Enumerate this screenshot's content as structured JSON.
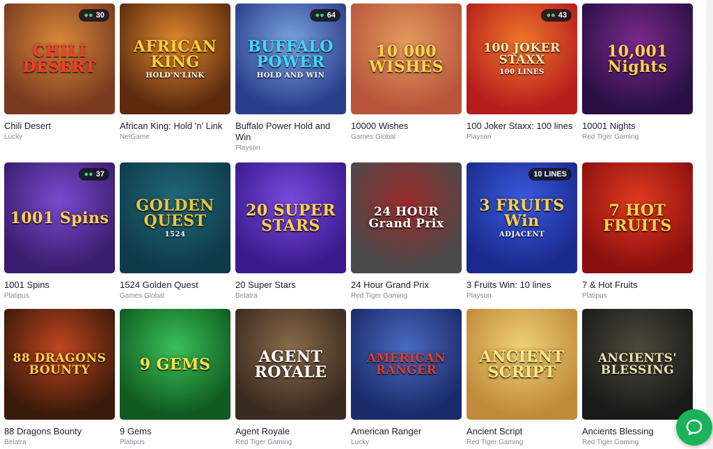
{
  "games": [
    {
      "title": "Chili Desert",
      "provider": "Lucky",
      "logo": "CHILI DESERT",
      "badge": "30",
      "bg": "#7a3a1f",
      "bg2": "#d98a3c",
      "logo_color": "#ff3a2a"
    },
    {
      "title": "African King: Hold 'n' Link",
      "provider": "NetGame",
      "logo": "AFRICAN KING",
      "sub": "HOLD'N'LINK",
      "bg": "#5b2a0f",
      "bg2": "#e0892e",
      "logo_color": "#ffcf3a"
    },
    {
      "title": "Buffalo Power Hold and Win",
      "provider": "Playson",
      "logo": "BUFFALO POWER",
      "sub": "HOLD AND WIN",
      "badge": "64",
      "bg": "#2a3e8c",
      "bg2": "#7ca4e0",
      "logo_color": "#3fd6ff"
    },
    {
      "title": "10000 Wishes",
      "provider": "Games Global",
      "logo": "10 000 WISHES",
      "bg": "#b8553a",
      "bg2": "#e39a5f",
      "logo_color": "#ffd24a"
    },
    {
      "title": "100 Joker Staxx: 100 lines",
      "provider": "Playson",
      "logo": "100 JOKER STAXX",
      "sub": "100 LINES",
      "badge": "43",
      "bg": "#b51d1d",
      "bg2": "#f0782a",
      "logo_color": "#ffe9b0"
    },
    {
      "title": "10001 Nights",
      "provider": "Red Tiger Gaming",
      "logo": "10,001 Nights",
      "bg": "#2a0f45",
      "bg2": "#7a2a8c",
      "logo_color": "#ffd24a"
    },
    {
      "title": "1001 Spins",
      "provider": "Platipus",
      "logo": "1001 Spins",
      "badge": "37",
      "bg": "#3a1d6e",
      "bg2": "#7a4acf",
      "logo_color": "#ffd24a"
    },
    {
      "title": "1524 Golden Quest",
      "provider": "Games Global",
      "logo": "GOLDEN QUEST",
      "sub": "1524",
      "bg": "#0f3a4a",
      "bg2": "#1f6a7a",
      "logo_color": "#f0c43a"
    },
    {
      "title": "20 Super Stars",
      "provider": "Belatra",
      "logo": "20 SUPER STARS",
      "bg": "#3a1a8c",
      "bg2": "#7a4ae0",
      "logo_color": "#ffd24a"
    },
    {
      "title": "24 Hour Grand Prix",
      "provider": "Red Tiger Gaming",
      "logo": "24 HOUR Grand Prix",
      "bg": "#4a4a4a",
      "bg2": "#9a2a2a",
      "logo_color": "#ffffff"
    },
    {
      "title": "3 Fruits Win: 10 lines",
      "provider": "Playson",
      "logo": "3 FRUITS Win",
      "sub": "ADJACENT",
      "tag": "10 LINES",
      "bg": "#1a2a8c",
      "bg2": "#3a5ae0",
      "logo_color": "#ffd24a"
    },
    {
      "title": "7 & Hot Fruits",
      "provider": "Platipus",
      "logo": "7 HOT FRUITS",
      "bg": "#8c0f0f",
      "bg2": "#e03a1f",
      "logo_color": "#ffd24a"
    },
    {
      "title": "88 Dragons Bounty",
      "provider": "Belatra",
      "logo": "88 DRAGONS BOUNTY",
      "bg": "#3a1a0a",
      "bg2": "#c0451f",
      "logo_color": "#ffd24a"
    },
    {
      "title": "9 Gems",
      "provider": "Platipus",
      "logo": "9 GEMS",
      "bg": "#0f5a1f",
      "bg2": "#3ac05a",
      "logo_color": "#ffe14a"
    },
    {
      "title": "Agent Royale",
      "provider": "Red Tiger Gaming",
      "logo": "AGENT ROYALE",
      "bg": "#3a2a1f",
      "bg2": "#8a6a4a",
      "logo_color": "#ffffff"
    },
    {
      "title": "American Ranger",
      "provider": "Lucky",
      "logo": "AMERICAN RANGER",
      "bg": "#1a2a6a",
      "bg2": "#4a6ac0",
      "logo_color": "#e03a2a"
    },
    {
      "title": "Ancient Script",
      "provider": "Red Tiger Gaming",
      "logo": "ANCIENT SCRIPT",
      "bg": "#c08a3a",
      "bg2": "#f0d07a",
      "logo_color": "#ffe87a"
    },
    {
      "title": "Ancients Blessing",
      "provider": "Red Tiger Gaming",
      "logo": "ANCIENTS' BLESSING",
      "bg": "#1a1a1a",
      "bg2": "#4a4a3a",
      "logo_color": "#f0e0b0"
    }
  ],
  "icons": {
    "players": "players-icon",
    "chat": "chat-icon"
  }
}
